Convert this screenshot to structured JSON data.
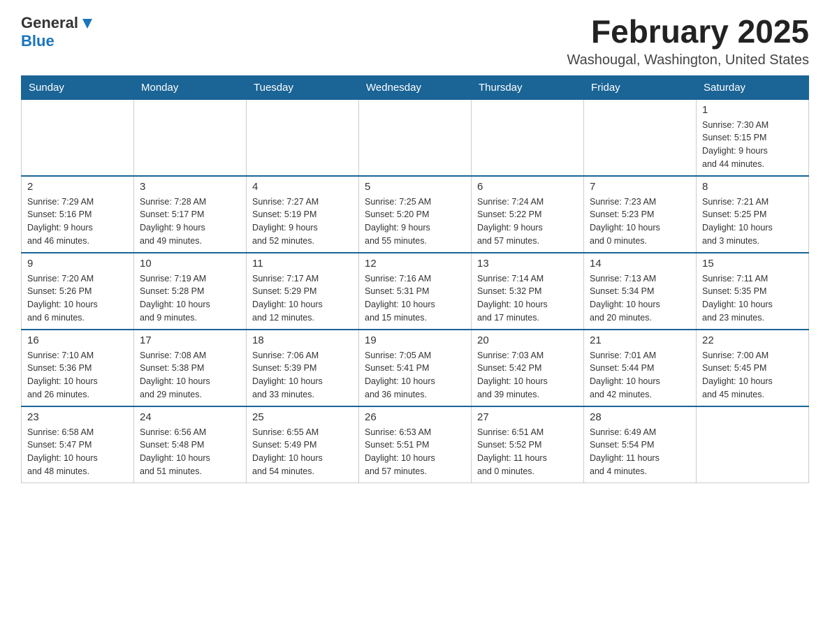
{
  "header": {
    "logo": {
      "general": "General",
      "blue": "Blue",
      "tagline": ""
    },
    "title": "February 2025",
    "location": "Washougal, Washington, United States"
  },
  "weekdays": [
    "Sunday",
    "Monday",
    "Tuesday",
    "Wednesday",
    "Thursday",
    "Friday",
    "Saturday"
  ],
  "weeks": [
    [
      {
        "day": "",
        "info": ""
      },
      {
        "day": "",
        "info": ""
      },
      {
        "day": "",
        "info": ""
      },
      {
        "day": "",
        "info": ""
      },
      {
        "day": "",
        "info": ""
      },
      {
        "day": "",
        "info": ""
      },
      {
        "day": "1",
        "info": "Sunrise: 7:30 AM\nSunset: 5:15 PM\nDaylight: 9 hours\nand 44 minutes."
      }
    ],
    [
      {
        "day": "2",
        "info": "Sunrise: 7:29 AM\nSunset: 5:16 PM\nDaylight: 9 hours\nand 46 minutes."
      },
      {
        "day": "3",
        "info": "Sunrise: 7:28 AM\nSunset: 5:17 PM\nDaylight: 9 hours\nand 49 minutes."
      },
      {
        "day": "4",
        "info": "Sunrise: 7:27 AM\nSunset: 5:19 PM\nDaylight: 9 hours\nand 52 minutes."
      },
      {
        "day": "5",
        "info": "Sunrise: 7:25 AM\nSunset: 5:20 PM\nDaylight: 9 hours\nand 55 minutes."
      },
      {
        "day": "6",
        "info": "Sunrise: 7:24 AM\nSunset: 5:22 PM\nDaylight: 9 hours\nand 57 minutes."
      },
      {
        "day": "7",
        "info": "Sunrise: 7:23 AM\nSunset: 5:23 PM\nDaylight: 10 hours\nand 0 minutes."
      },
      {
        "day": "8",
        "info": "Sunrise: 7:21 AM\nSunset: 5:25 PM\nDaylight: 10 hours\nand 3 minutes."
      }
    ],
    [
      {
        "day": "9",
        "info": "Sunrise: 7:20 AM\nSunset: 5:26 PM\nDaylight: 10 hours\nand 6 minutes."
      },
      {
        "day": "10",
        "info": "Sunrise: 7:19 AM\nSunset: 5:28 PM\nDaylight: 10 hours\nand 9 minutes."
      },
      {
        "day": "11",
        "info": "Sunrise: 7:17 AM\nSunset: 5:29 PM\nDaylight: 10 hours\nand 12 minutes."
      },
      {
        "day": "12",
        "info": "Sunrise: 7:16 AM\nSunset: 5:31 PM\nDaylight: 10 hours\nand 15 minutes."
      },
      {
        "day": "13",
        "info": "Sunrise: 7:14 AM\nSunset: 5:32 PM\nDaylight: 10 hours\nand 17 minutes."
      },
      {
        "day": "14",
        "info": "Sunrise: 7:13 AM\nSunset: 5:34 PM\nDaylight: 10 hours\nand 20 minutes."
      },
      {
        "day": "15",
        "info": "Sunrise: 7:11 AM\nSunset: 5:35 PM\nDaylight: 10 hours\nand 23 minutes."
      }
    ],
    [
      {
        "day": "16",
        "info": "Sunrise: 7:10 AM\nSunset: 5:36 PM\nDaylight: 10 hours\nand 26 minutes."
      },
      {
        "day": "17",
        "info": "Sunrise: 7:08 AM\nSunset: 5:38 PM\nDaylight: 10 hours\nand 29 minutes."
      },
      {
        "day": "18",
        "info": "Sunrise: 7:06 AM\nSunset: 5:39 PM\nDaylight: 10 hours\nand 33 minutes."
      },
      {
        "day": "19",
        "info": "Sunrise: 7:05 AM\nSunset: 5:41 PM\nDaylight: 10 hours\nand 36 minutes."
      },
      {
        "day": "20",
        "info": "Sunrise: 7:03 AM\nSunset: 5:42 PM\nDaylight: 10 hours\nand 39 minutes."
      },
      {
        "day": "21",
        "info": "Sunrise: 7:01 AM\nSunset: 5:44 PM\nDaylight: 10 hours\nand 42 minutes."
      },
      {
        "day": "22",
        "info": "Sunrise: 7:00 AM\nSunset: 5:45 PM\nDaylight: 10 hours\nand 45 minutes."
      }
    ],
    [
      {
        "day": "23",
        "info": "Sunrise: 6:58 AM\nSunset: 5:47 PM\nDaylight: 10 hours\nand 48 minutes."
      },
      {
        "day": "24",
        "info": "Sunrise: 6:56 AM\nSunset: 5:48 PM\nDaylight: 10 hours\nand 51 minutes."
      },
      {
        "day": "25",
        "info": "Sunrise: 6:55 AM\nSunset: 5:49 PM\nDaylight: 10 hours\nand 54 minutes."
      },
      {
        "day": "26",
        "info": "Sunrise: 6:53 AM\nSunset: 5:51 PM\nDaylight: 10 hours\nand 57 minutes."
      },
      {
        "day": "27",
        "info": "Sunrise: 6:51 AM\nSunset: 5:52 PM\nDaylight: 11 hours\nand 0 minutes."
      },
      {
        "day": "28",
        "info": "Sunrise: 6:49 AM\nSunset: 5:54 PM\nDaylight: 11 hours\nand 4 minutes."
      },
      {
        "day": "",
        "info": ""
      }
    ]
  ]
}
